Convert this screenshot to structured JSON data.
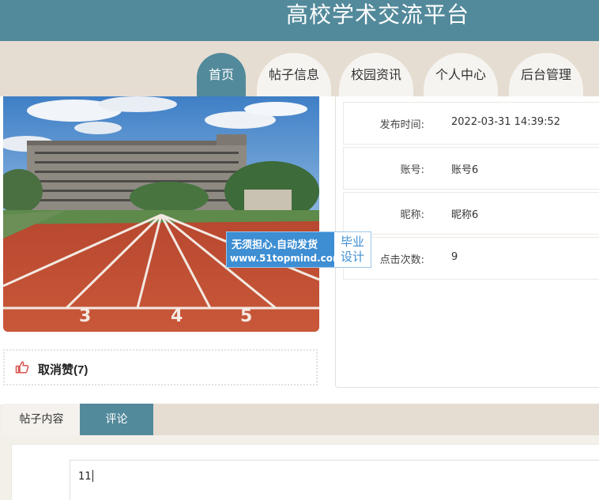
{
  "header": {
    "title": "高校学术交流平台"
  },
  "nav": {
    "items": [
      {
        "label": "首页"
      },
      {
        "label": "帖子信息"
      },
      {
        "label": "校园资讯"
      },
      {
        "label": "个人中心"
      },
      {
        "label": "后台管理"
      }
    ]
  },
  "like": {
    "label": "取消赞(7)",
    "icon": "thumbs-up-icon"
  },
  "info": {
    "rows": [
      {
        "label": "发布时间:",
        "value": "2022-03-31 14:39:52"
      },
      {
        "label": "账号:",
        "value": "账号6"
      },
      {
        "label": "昵称:",
        "value": "昵称6"
      },
      {
        "label": "点击次数:",
        "value": "9"
      }
    ]
  },
  "watermark": {
    "line1": "无须担心.自动发货",
    "line2": "www.51topmind.com",
    "badge_top": "毕业",
    "badge_bottom": "设计"
  },
  "tabs": [
    {
      "label": "帖子内容"
    },
    {
      "label": "评论"
    }
  ],
  "comment": {
    "value": "11"
  },
  "colors": {
    "primary": "#538a9b",
    "band": "#e6ddd2",
    "like_icon": "#d9534f"
  }
}
